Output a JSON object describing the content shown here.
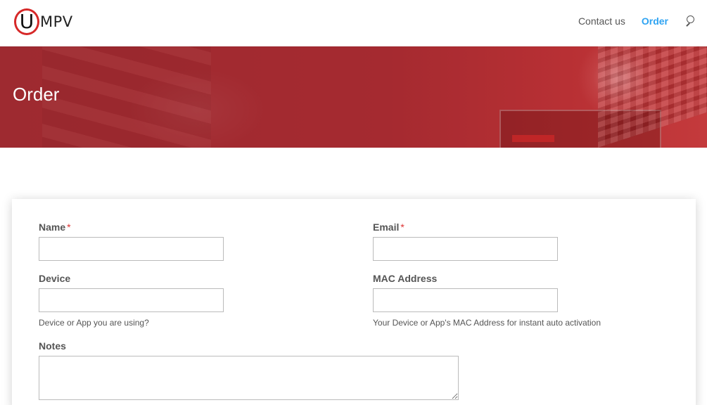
{
  "brand": {
    "logo_letter": "U",
    "logo_rest": "MPV",
    "accent_color": "#d62828"
  },
  "nav": {
    "items": [
      {
        "label": "Contact us",
        "active": false
      },
      {
        "label": "Order",
        "active": true
      }
    ],
    "active_color": "#2ea3f2",
    "search_icon": "search-icon"
  },
  "hero": {
    "title": "Order",
    "background_color": "#a52a30"
  },
  "form": {
    "name": {
      "label": "Name",
      "required_mark": "*",
      "value": ""
    },
    "email": {
      "label": "Email",
      "required_mark": "*",
      "value": ""
    },
    "device": {
      "label": "Device",
      "value": "",
      "description": "Device or App you are using?"
    },
    "mac": {
      "label": "MAC Address",
      "value": "",
      "description": "Your Device or App's MAC Address for instant auto activation"
    },
    "notes": {
      "label": "Notes",
      "value": ""
    }
  }
}
